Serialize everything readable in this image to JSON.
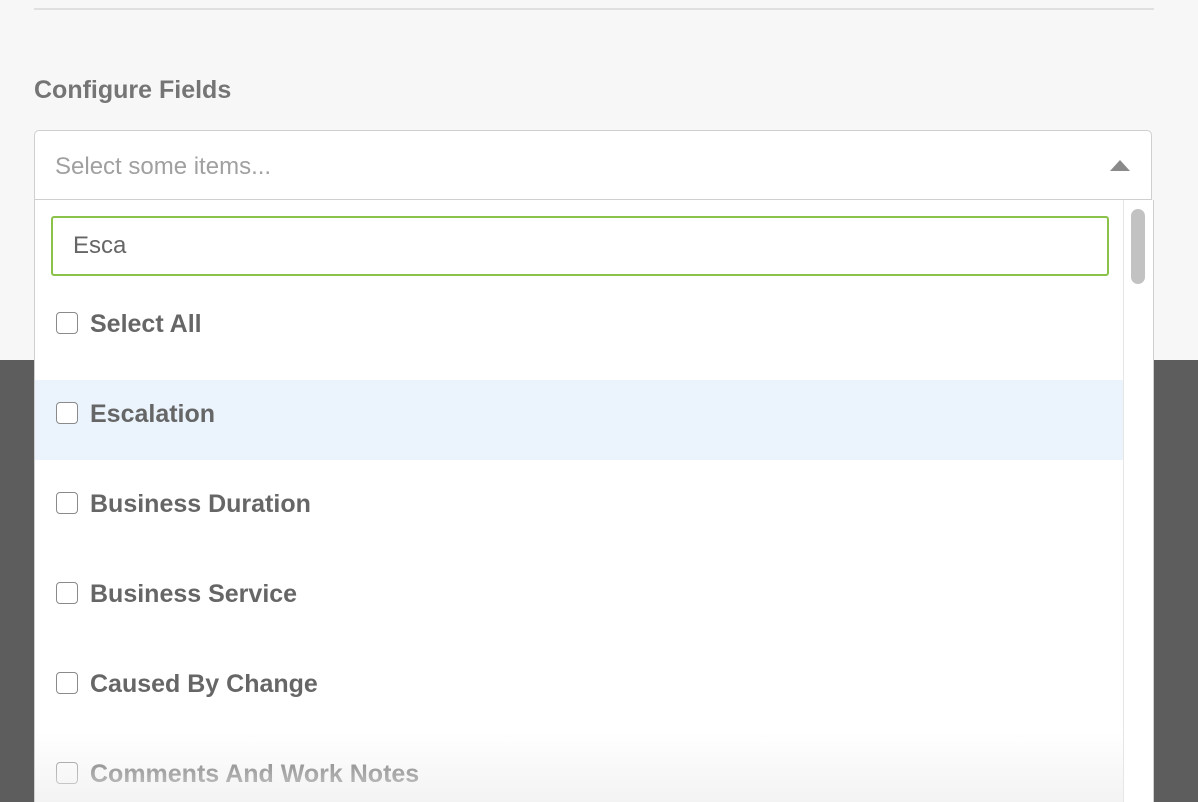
{
  "section": {
    "label": "Configure Fields"
  },
  "select": {
    "placeholder": "Select some items..."
  },
  "search": {
    "value": "Esca"
  },
  "options": [
    {
      "label": "Select All",
      "checked": false,
      "highlighted": false
    },
    {
      "label": "Escalation",
      "checked": false,
      "highlighted": true
    },
    {
      "label": "Business Duration",
      "checked": false,
      "highlighted": false
    },
    {
      "label": "Business Service",
      "checked": false,
      "highlighted": false
    },
    {
      "label": "Caused By Change",
      "checked": false,
      "highlighted": false
    },
    {
      "label": "Comments And Work Notes",
      "checked": false,
      "highlighted": false
    }
  ],
  "colors": {
    "search_border": "#8bc34a",
    "highlight_row": "#ebf4fd",
    "overlay": "#5d5d5d"
  },
  "icons": {
    "caret": "caret-up-icon"
  }
}
